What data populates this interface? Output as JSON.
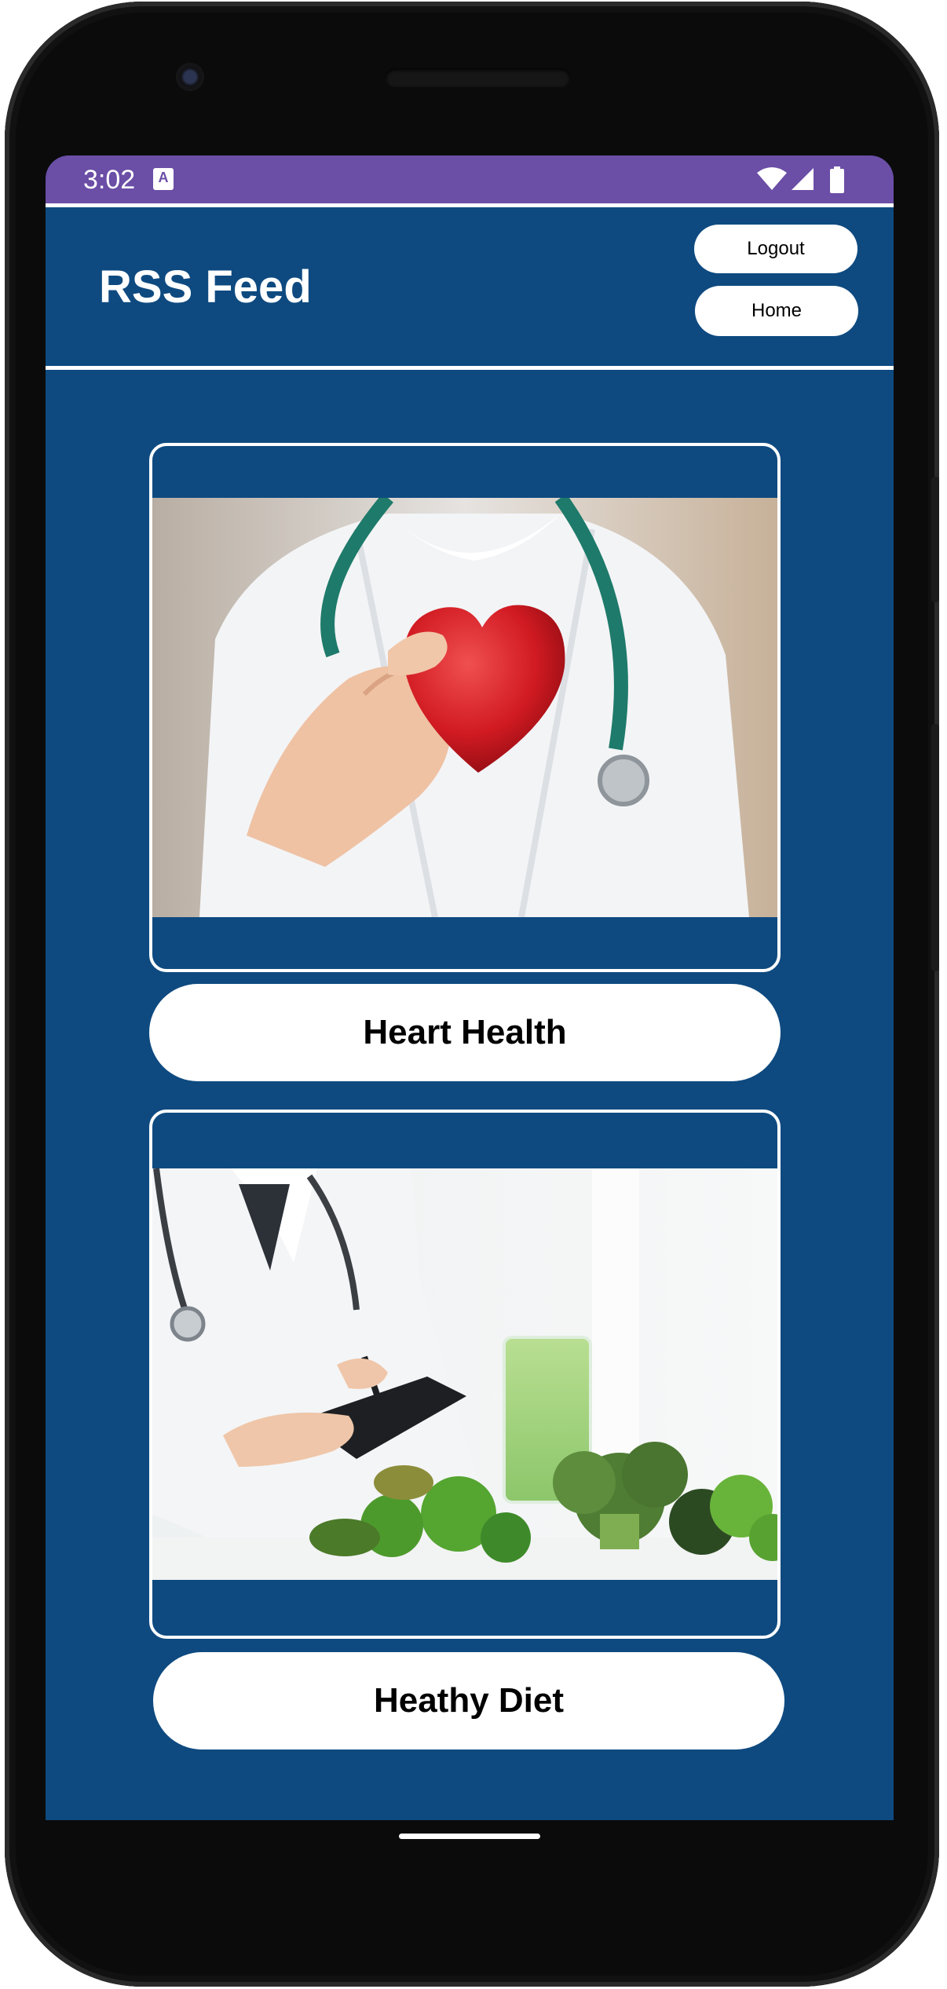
{
  "status_bar": {
    "time": "3:02",
    "keyboard_badge": "A",
    "icons": [
      "wifi-icon",
      "cell-signal-icon",
      "battery-icon"
    ]
  },
  "header": {
    "title": "RSS Feed",
    "logout_label": "Logout",
    "home_label": "Home"
  },
  "feed": {
    "items": [
      {
        "label": "Heart Health",
        "image": "doctor-holding-heart-image"
      },
      {
        "label": "Heathy Diet",
        "image": "doctor-with-vegetables-image"
      }
    ]
  },
  "colors": {
    "status_bar": "#6b4ea6",
    "background": "#0e4a80",
    "button": "#ffffff",
    "text_on_button": "#000000"
  }
}
